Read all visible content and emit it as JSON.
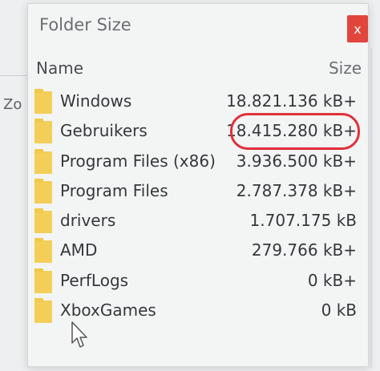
{
  "background": {
    "partial_text": "Zo"
  },
  "window": {
    "title": "Folder Size",
    "close_label": "x",
    "columns": {
      "name": "Name",
      "size": "Size"
    },
    "highlight_color": "#e0303a",
    "folder_color": "#f3cf5a",
    "close_color": "#e2453b",
    "rows": [
      {
        "name": "Windows",
        "size": "18.821.136 kB+"
      },
      {
        "name": "Gebruikers",
        "size": "18.415.280 kB+"
      },
      {
        "name": "Program Files (x86)",
        "size": "3.936.500 kB+"
      },
      {
        "name": "Program Files",
        "size": "2.787.378 kB+"
      },
      {
        "name": "drivers",
        "size": "1.707.175 kB"
      },
      {
        "name": "AMD",
        "size": "279.766 kB+"
      },
      {
        "name": "PerfLogs",
        "size": "0 kB+"
      },
      {
        "name": "XboxGames",
        "size": "0 kB"
      }
    ],
    "highlighted_row_index": 1
  }
}
